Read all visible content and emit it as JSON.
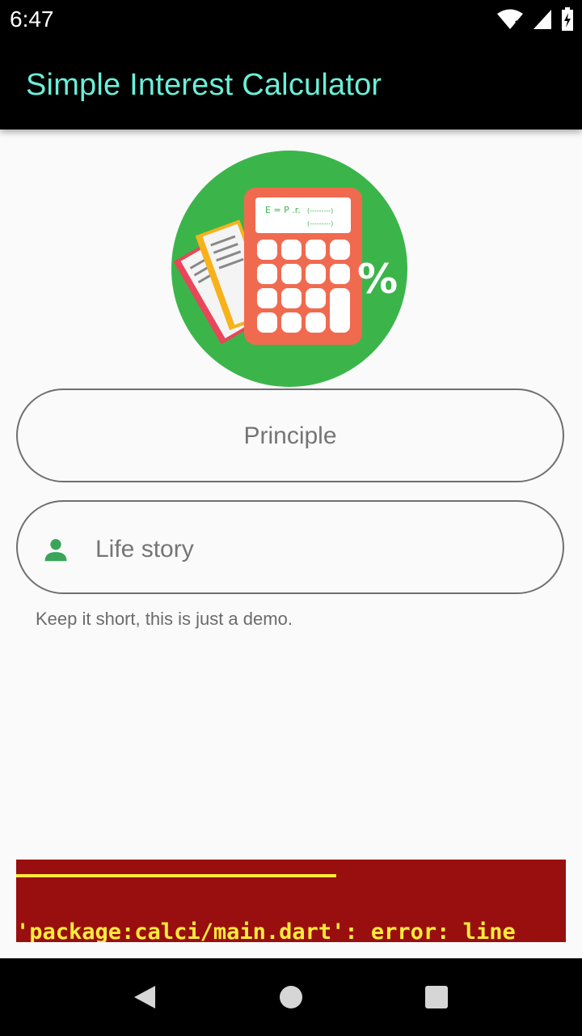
{
  "status_bar": {
    "time": "6:47",
    "icons": [
      "wifi-icon",
      "cellular-signal-icon",
      "battery-charging-icon"
    ]
  },
  "app_bar": {
    "title": "Simple Interest Calculator",
    "title_color": "#69f0d8"
  },
  "logo": {
    "formula_line1": "E = P .r.",
    "formula_line2": "(---------)",
    "formula_line3": "(---------)",
    "percent_symbol": "%",
    "circle_color": "#3bb54a",
    "calculator_color": "#f06a50"
  },
  "form": {
    "principle": {
      "label": "Principle"
    },
    "life_story": {
      "label": "Life story",
      "icon": "person-icon",
      "helper": "Keep it short, this is just a demo."
    }
  },
  "error_banner": {
    "text": "'package:calci/main.dart': error: line",
    "background": "#990f0f",
    "text_color": "#ffeb3b"
  },
  "nav_bar": {
    "buttons": [
      "back-icon",
      "home-icon",
      "recents-icon"
    ]
  }
}
